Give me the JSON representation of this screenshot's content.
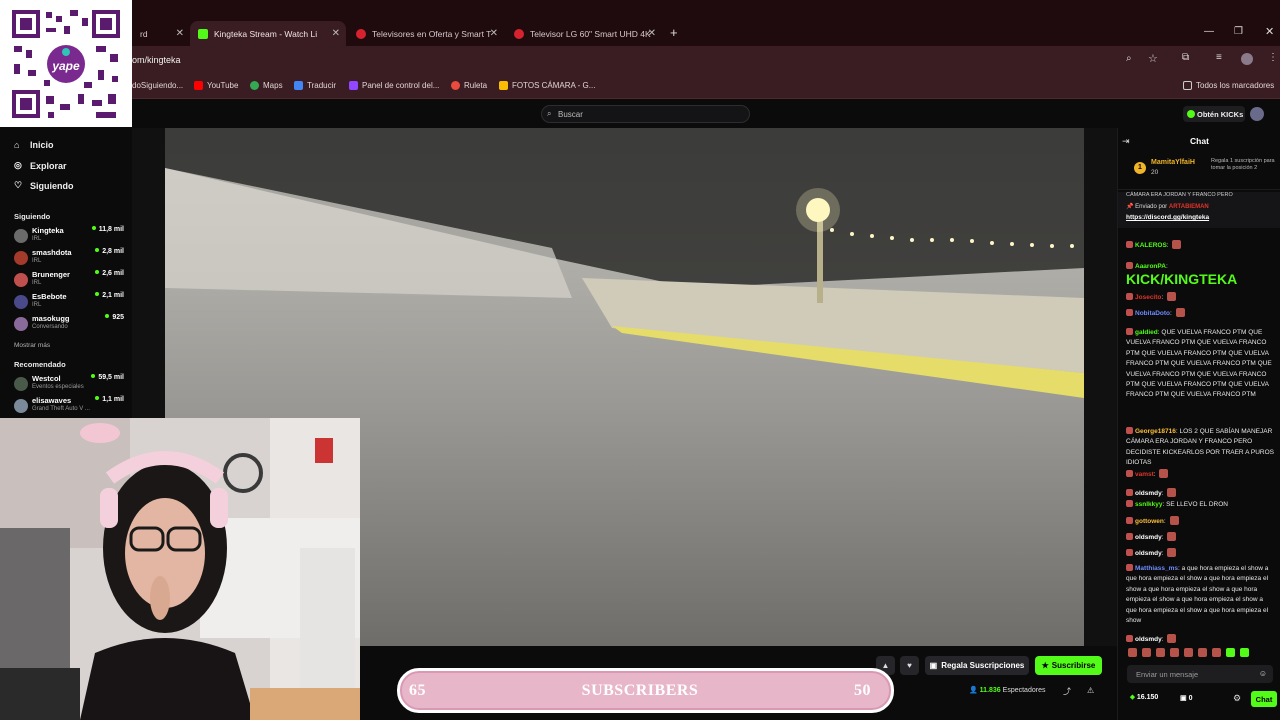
{
  "browser": {
    "tabs": [
      {
        "title": "rd",
        "icon": "dashboard-tab-icon"
      },
      {
        "title": "Kingteka Stream - Watch Li",
        "icon": "kick-icon",
        "active": true
      },
      {
        "title": "Televisores en Oferta y Smart T",
        "icon": "store-icon"
      },
      {
        "title": "Televisor LG 60\" Smart UHD 4K",
        "icon": "store-icon"
      }
    ],
    "new_tab_label": "+",
    "url": "om/kingteka",
    "bookmarks": [
      "doSiguiendo...",
      "YouTube",
      "Maps",
      "Traducir",
      "Panel de control del...",
      "Ruleta",
      "FOTOS CÁMARA - G..."
    ],
    "all_bookmarks_label": "Todos los marcadores"
  },
  "header": {
    "search_placeholder": "Buscar",
    "get_kicks_label": "Obtén KICKs"
  },
  "sidebar": {
    "nav": [
      {
        "label": "Inicio",
        "icon": "home-icon"
      },
      {
        "label": "Explorar",
        "icon": "compass-icon"
      },
      {
        "label": "Siguiendo",
        "icon": "heart-icon"
      }
    ],
    "following_heading": "Siguiendo",
    "following": [
      {
        "name": "Kingteka",
        "category": "IRL",
        "viewers": "11,8 mil",
        "color": "#6b6b6b"
      },
      {
        "name": "smashdota",
        "category": "IRL",
        "viewers": "2,8 mil",
        "color": "#a33a2a"
      },
      {
        "name": "Brunenger",
        "category": "IRL",
        "viewers": "2,6 mil",
        "color": "#c0504d"
      },
      {
        "name": "EsBebote",
        "category": "IRL",
        "viewers": "2,1 mil",
        "color": "#4a4a8a"
      },
      {
        "name": "masokugg",
        "category": "Conversando",
        "viewers": "925",
        "color": "#8a6a9a"
      }
    ],
    "show_more": "Mostrar más",
    "recommended_heading": "Recomendado",
    "recommended": [
      {
        "name": "Westcol",
        "category": "Eventos especiales",
        "viewers": "59,5 mil",
        "color": "#4a5a4a"
      },
      {
        "name": "elisawaves",
        "category": "Grand Theft Auto V ...",
        "viewers": "1,1 mil",
        "color": "#7a8a9a"
      }
    ]
  },
  "overlay": {
    "subs_left": "65",
    "subs_label": "SUBSCRIBERS",
    "subs_right": "50"
  },
  "player": {
    "gift_subs_label": "Regala Suscripciones",
    "subscribe_label": "Suscribirse",
    "viewers_count": "11.836",
    "viewers_label": "Espectadores"
  },
  "chat": {
    "title": "Chat",
    "top_gifter": {
      "name": "MamitaYlfaiH",
      "count": "20",
      "note": "Regala 1 suscripción para tomar la posición 2"
    },
    "pinned": {
      "above": "CÁMARA ERA JORDAN Y FRANCO PERO",
      "sent_by_label": "Enviado por",
      "sent_by_user": "ARTABIEMAN",
      "link": "https://discord.gg/kingteka"
    },
    "messages": [
      {
        "user": "KALEROS",
        "color": "#53fc18",
        "text": ""
      },
      {
        "user": "AaaronPA",
        "color": "#53fc18",
        "text": "KICK/KINGTEKA"
      },
      {
        "user": "Josecito",
        "color": "#e0342a",
        "text": ""
      },
      {
        "user": "NobitaDoto",
        "color": "#6f8cff",
        "text": ""
      },
      {
        "user": "galdied",
        "color": "#53fc18",
        "text": "QUE VUELVA FRANCO PTM QUE VUELVA FRANCO PTM QUE VUELVA FRANCO PTM QUE VUELVA FRANCO PTM QUE VUELVA FRANCO PTM QUE VUELVA FRANCO PTM QUE VUELVA FRANCO PTM QUE VUELVA FRANCO PTM QUE VUELVA FRANCO PTM QUE VUELVA FRANCO PTM QUE VUELVA FRANCO PTM"
      },
      {
        "user": "George18716",
        "color": "#ffbf3a",
        "text": "LOS 2 QUE SABÍAN MANEJAR CÁMARA ERA JORDAN Y FRANCO PERO DECIDISTE KICKEARLOS POR TRAER A PUROS IDIOTAS"
      },
      {
        "user": "vamst",
        "color": "#e0342a",
        "text": ""
      },
      {
        "user": "oldsmdy",
        "color": "#ffffff",
        "text": ""
      },
      {
        "user": "ssnlkkyy",
        "color": "#53fc18",
        "text": "SE LLEVO EL DRON"
      },
      {
        "user": "gottowen",
        "color": "#ffbf3a",
        "text": ""
      },
      {
        "user": "oldsmdy",
        "color": "#ffffff",
        "text": ""
      },
      {
        "user": "oldsmdy",
        "color": "#ffffff",
        "text": ""
      },
      {
        "user": "Matthiass_ms",
        "color": "#6f8cff",
        "text": "a que hora empieza el show a que hora empieza el show a que hora empieza el show a que hora empieza el show a que hora empieza el show a que hora empieza el show a que hora empieza el show a que hora empieza el show"
      },
      {
        "user": "oldsmdy",
        "color": "#ffffff",
        "text": ""
      }
    ],
    "input_placeholder": "Enviar un mensaje",
    "kicks_balance": "16.150",
    "extra_count": "0",
    "chat_button_label": "Chat"
  },
  "colors": {
    "accent": "#53fc18",
    "browser_chrome": "#3a1d22"
  }
}
